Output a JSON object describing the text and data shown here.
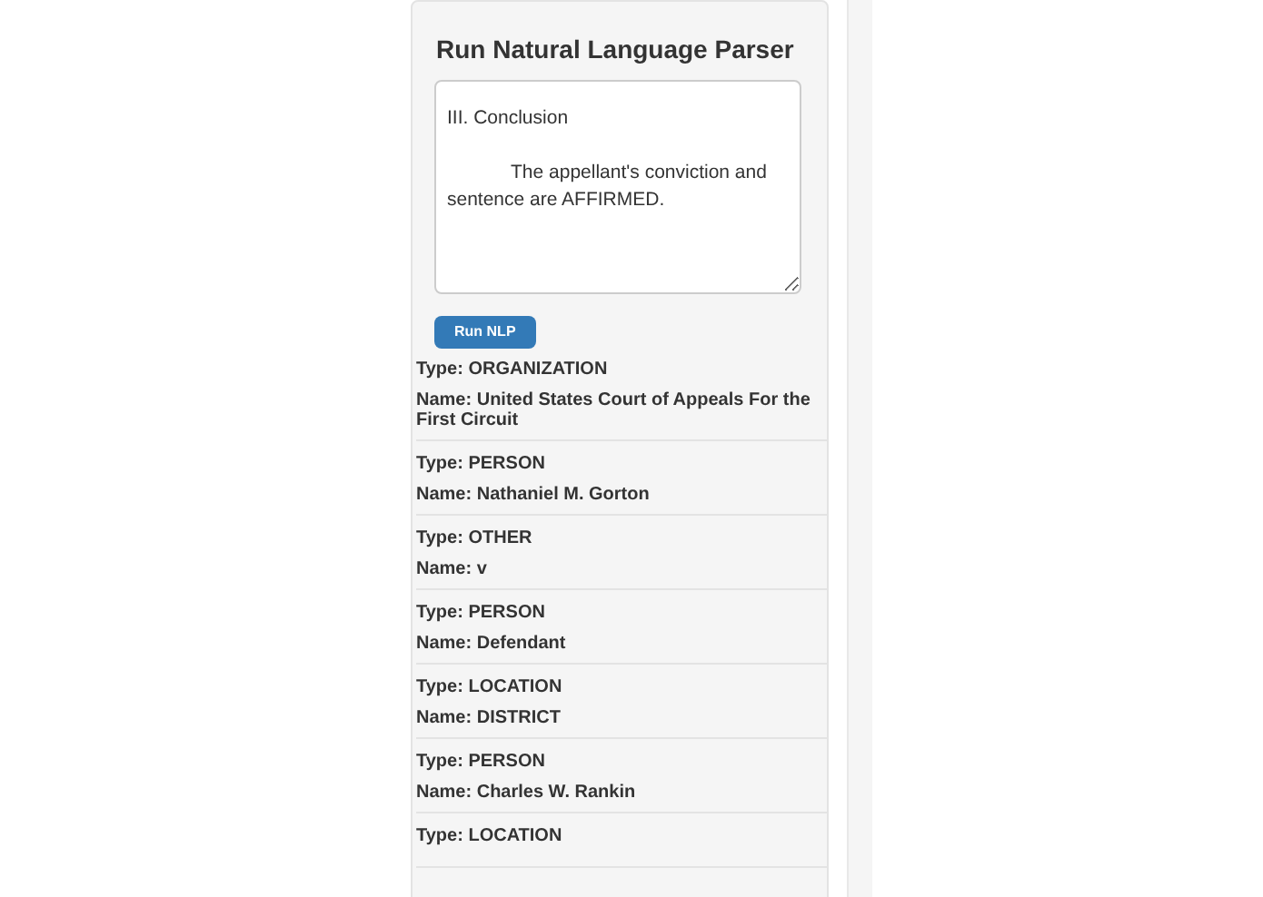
{
  "panel": {
    "title": "Run Natural Language Parser"
  },
  "textarea": {
    "value": "III. Conclusion\n\n            The appellant's conviction and sentence are AFFIRMED."
  },
  "button": {
    "label": "Run NLP"
  },
  "entities": [
    {
      "type": "Type: ORGANIZATION",
      "name": "Name: United States Court of Appeals For the First Circuit"
    },
    {
      "type": "Type: PERSON",
      "name": "Name: Nathaniel M. Gorton"
    },
    {
      "type": "Type: OTHER",
      "name": "Name: v"
    },
    {
      "type": "Type: PERSON",
      "name": "Name: Defendant"
    },
    {
      "type": "Type: LOCATION",
      "name": "Name: DISTRICT"
    },
    {
      "type": "Type: PERSON",
      "name": "Name: Charles W. Rankin"
    },
    {
      "type": "Type: LOCATION"
    }
  ]
}
